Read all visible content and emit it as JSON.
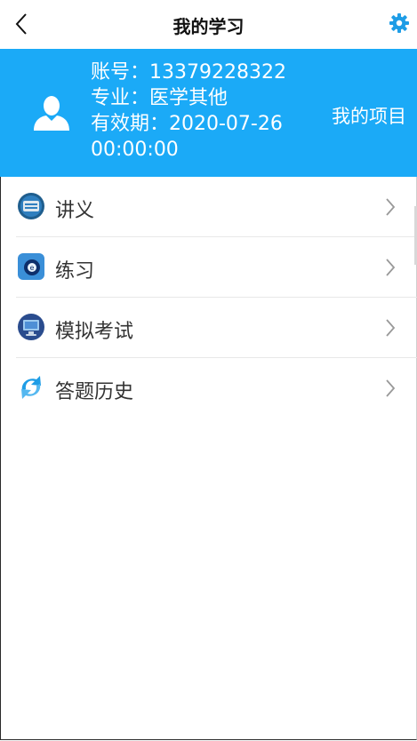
{
  "header": {
    "title": "我的学习",
    "back_icon": "chevron-left-icon",
    "settings_icon": "gear-icon"
  },
  "profile": {
    "account": "账号：13379228322",
    "major": "专业：医学其他",
    "valid_line1": "有效期：2020-07-26",
    "valid_line2": "00:00:00",
    "project_link": "我的项目",
    "banner_color": "#1baaf7"
  },
  "menu": [
    {
      "label": "讲义",
      "icon": "book-icon"
    },
    {
      "label": "练习",
      "icon": "practice-icon"
    },
    {
      "label": "模拟考试",
      "icon": "monitor-icon"
    },
    {
      "label": "答题历史",
      "icon": "history-icon"
    }
  ]
}
